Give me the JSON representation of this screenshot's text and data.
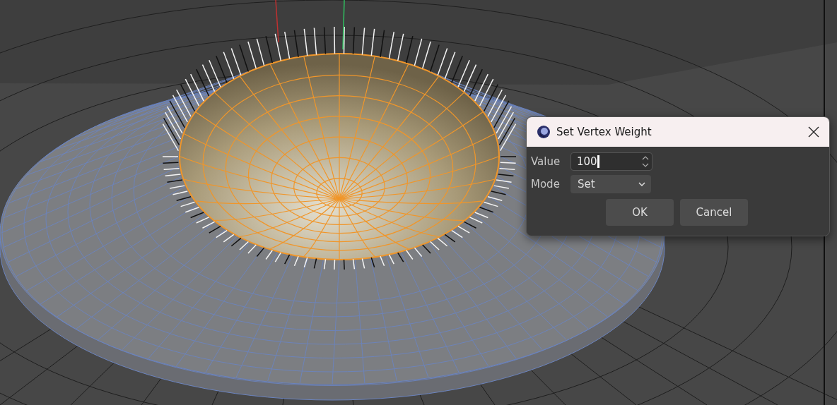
{
  "dialog": {
    "title": "Set Vertex Weight",
    "fields": [
      {
        "kind": "number",
        "label": "Value",
        "value": "100"
      },
      {
        "kind": "select",
        "label": "Mode",
        "value": "Set"
      }
    ],
    "buttons": [
      "OK",
      "Cancel"
    ]
  }
}
